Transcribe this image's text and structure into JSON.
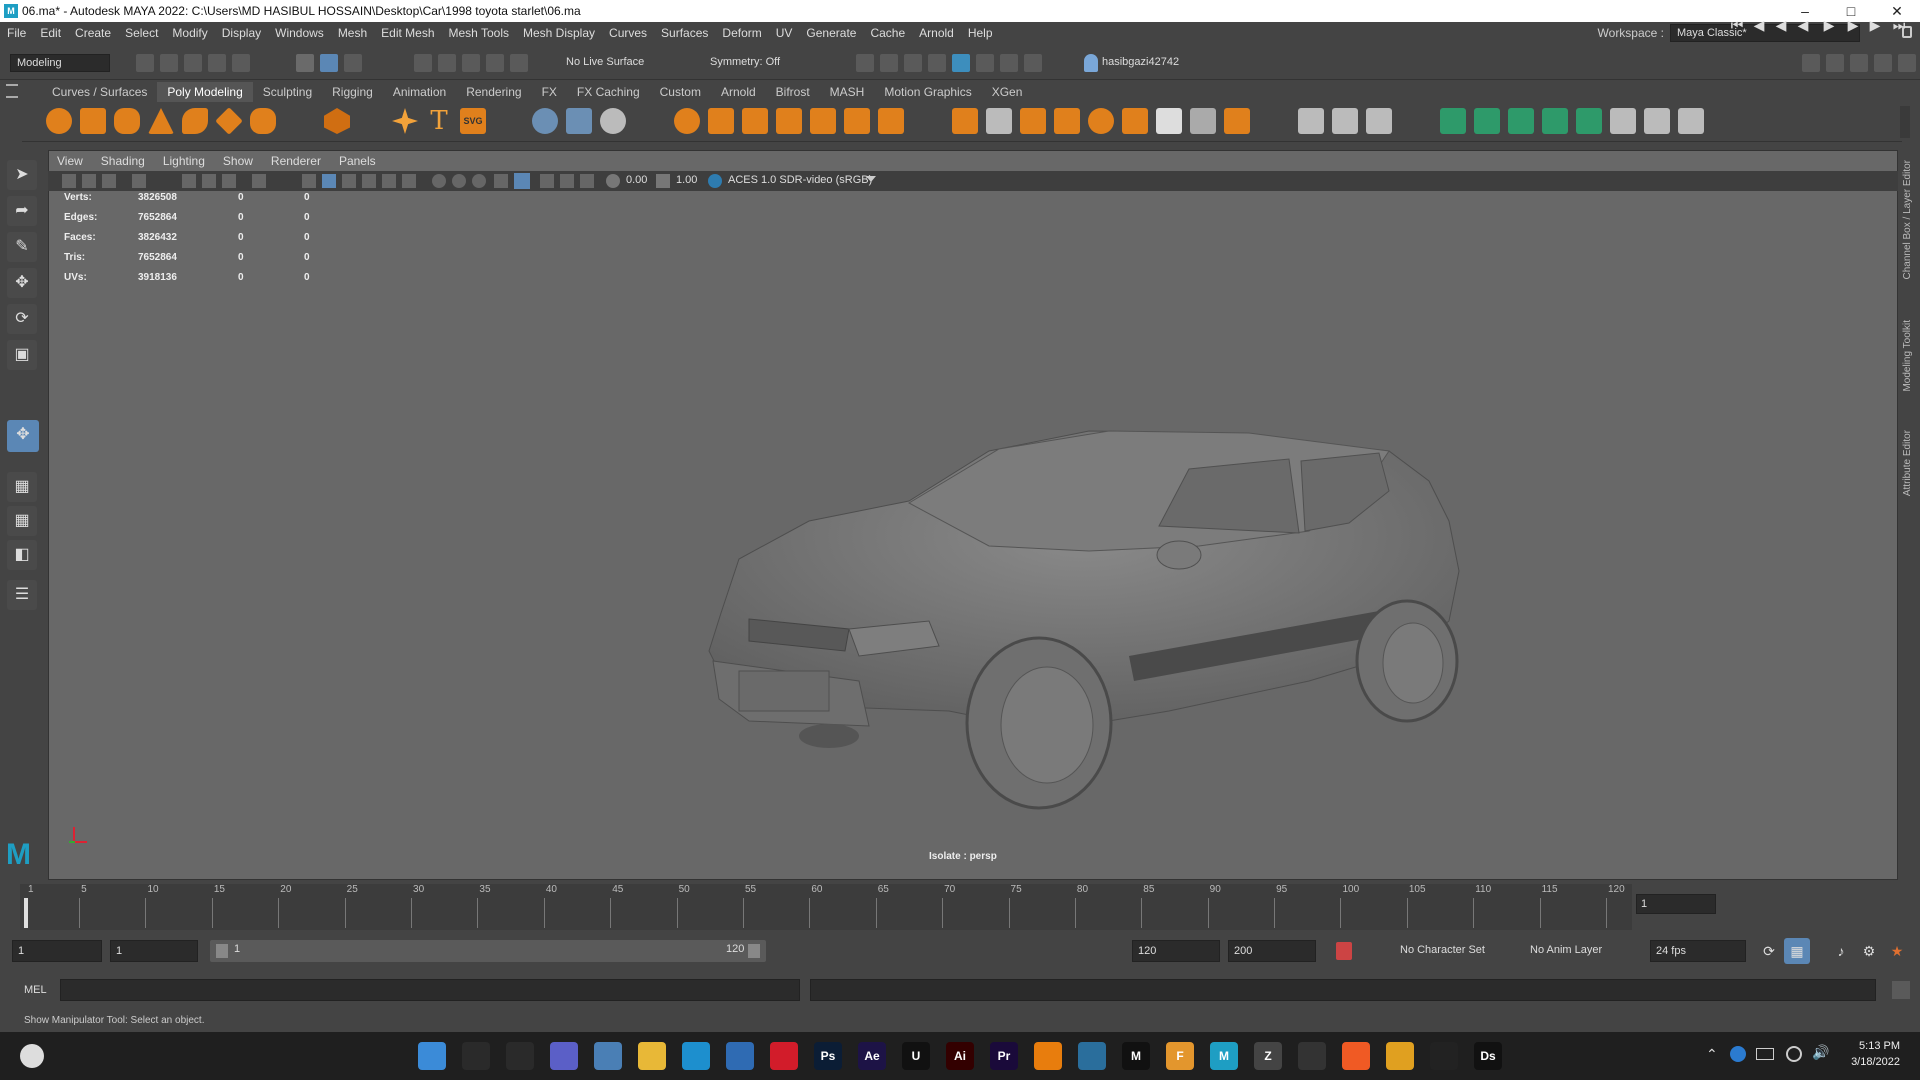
{
  "window": {
    "title": "06.ma* - Autodesk MAYA 2022: C:\\Users\\MD HASIBUL HOSSAIN\\Desktop\\Car\\1998 toyota starlet\\06.ma",
    "app_icon": "M"
  },
  "menu": [
    "File",
    "Edit",
    "Create",
    "Select",
    "Modify",
    "Display",
    "Windows",
    "Mesh",
    "Edit Mesh",
    "Mesh Tools",
    "Mesh Display",
    "Curves",
    "Surfaces",
    "Deform",
    "UV",
    "Generate",
    "Cache",
    "Arnold",
    "Help"
  ],
  "workspace": {
    "label": "Workspace :",
    "value": "Maya Classic*"
  },
  "status": {
    "mode": "Modeling",
    "live_surface": "No Live Surface",
    "symmetry": "Symmetry: Off",
    "user": "hasibgazi42742"
  },
  "shelf_tabs": [
    "Curves / Surfaces",
    "Poly Modeling",
    "Sculpting",
    "Rigging",
    "Animation",
    "Rendering",
    "FX",
    "FX Caching",
    "Custom",
    "Arnold",
    "Bifrost",
    "MASH",
    "Motion Graphics",
    "XGen"
  ],
  "shelf_active": "Poly Modeling",
  "viewport": {
    "menu": [
      "View",
      "Shading",
      "Lighting",
      "Show",
      "Renderer",
      "Panels"
    ],
    "exposure": "0.00",
    "gamma": "1.00",
    "color_space": "ACES 1.0 SDR-video (sRGB)",
    "caption": "Isolate : persp"
  },
  "hud": [
    {
      "label": "Verts:",
      "value": "3826508",
      "a": "0",
      "b": "0"
    },
    {
      "label": "Edges:",
      "value": "7652864",
      "a": "0",
      "b": "0"
    },
    {
      "label": "Faces:",
      "value": "3826432",
      "a": "0",
      "b": "0"
    },
    {
      "label": "Tris:",
      "value": "7652864",
      "a": "0",
      "b": "0"
    },
    {
      "label": "UVs:",
      "value": "3918136",
      "a": "0",
      "b": "0"
    }
  ],
  "right_rail": [
    "Channel Box / Layer Editor",
    "Modeling Toolkit",
    "Attribute Editor"
  ],
  "timeline": {
    "ticks": [
      "1",
      "5",
      "10",
      "15",
      "20",
      "25",
      "30",
      "35",
      "40",
      "45",
      "50",
      "55",
      "60",
      "65",
      "70",
      "75",
      "80",
      "85",
      "90",
      "95",
      "100",
      "105",
      "110",
      "115",
      "120"
    ],
    "current_frame": "1"
  },
  "range": {
    "start": "1",
    "inner_start": "1",
    "slider_start": "1",
    "slider_end": "120",
    "end": "120",
    "max": "200",
    "char_set": "No Character Set",
    "anim_layer": "No Anim Layer",
    "fps": "24 fps"
  },
  "cmd": {
    "label": "MEL"
  },
  "help_text": "Show Manipulator Tool: Select an object.",
  "taskbar": {
    "time": "5:13 PM",
    "date": "3/18/2022",
    "apps": [
      {
        "name": "windows-start",
        "text": "",
        "color": "#3b8bd8"
      },
      {
        "name": "search",
        "text": "",
        "color": "#2a2a2a"
      },
      {
        "name": "task-view",
        "text": "",
        "color": "#2a2a2a"
      },
      {
        "name": "teams",
        "text": "",
        "color": "#5b5fc7"
      },
      {
        "name": "photos",
        "text": "",
        "color": "#4a7fb5"
      },
      {
        "name": "file-explorer",
        "text": "",
        "color": "#e8b837"
      },
      {
        "name": "edge",
        "text": "",
        "color": "#1d8fce"
      },
      {
        "name": "store",
        "text": "",
        "color": "#2f6bb3"
      },
      {
        "name": "opera",
        "text": "",
        "color": "#d21c2a"
      },
      {
        "name": "photoshop",
        "text": "Ps",
        "color": "#0b1d35"
      },
      {
        "name": "after-effects",
        "text": "Ae",
        "color": "#1d1346"
      },
      {
        "name": "unreal",
        "text": "U",
        "color": "#111"
      },
      {
        "name": "illustrator",
        "text": "Ai",
        "color": "#330000"
      },
      {
        "name": "premiere",
        "text": "Pr",
        "color": "#1a0a3a"
      },
      {
        "name": "blender",
        "text": "",
        "color": "#e87d0d"
      },
      {
        "name": "davinci",
        "text": "",
        "color": "#2a6e9c"
      },
      {
        "name": "marmoset",
        "text": "M",
        "color": "#111"
      },
      {
        "name": "figma-f",
        "text": "F",
        "color": "#e3962d"
      },
      {
        "name": "maya",
        "text": "M",
        "color": "#1e9ec3"
      },
      {
        "name": "zbrush",
        "text": "Z",
        "color": "#444"
      },
      {
        "name": "cinema4d",
        "text": "",
        "color": "#333"
      },
      {
        "name": "brave",
        "text": "",
        "color": "#f05a24"
      },
      {
        "name": "chrome",
        "text": "",
        "color": "#e0a020"
      },
      {
        "name": "unity",
        "text": "",
        "color": "#222"
      },
      {
        "name": "daz",
        "text": "Ds",
        "color": "#111"
      }
    ]
  }
}
